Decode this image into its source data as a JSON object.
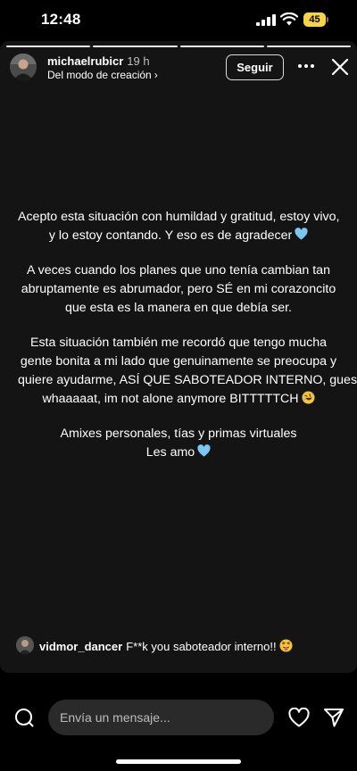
{
  "status_bar": {
    "time": "12:48",
    "battery_level": "45",
    "icons": [
      "signal-icon",
      "wifi-icon",
      "battery-icon"
    ],
    "battery_color": "#f7d548"
  },
  "story": {
    "progress": {
      "segments": 4,
      "current": 4
    },
    "user": {
      "username": "michaelrubicr",
      "age": "19 h",
      "subtitle": "Del modo de creación",
      "subtitle_chevron": "›"
    },
    "follow_label": "Seguir",
    "more_icon": "more-horizontal-icon",
    "close_icon": "close-icon",
    "paragraphs": [
      {
        "lines": [
          "Acepto esta situación con humildad y gratitud, estoy vivo,",
          "y lo estoy contando. Y eso es de agradecer"
        ],
        "emoji": "blue-heart"
      },
      {
        "lines": [
          "A veces cuando los planes que uno tenía cambian tan",
          "abruptamente es abrumador, pero SÉ en mi corazoncito",
          "que esta es la manera en que debía ser."
        ]
      },
      {
        "lines": [
          "Esta situación también me recordó que tengo mucha",
          "gente bonita a mi lado que genuinamente se preocupa y",
          "quiere ayudarme, ASÍ QUE SABOTEADOR INTERNO, guess",
          "whaaaaat, im not alone anymore BITTTTTCH"
        ],
        "emoji": "rolling-laughing"
      },
      {
        "lines": [
          "Amixes personales, tías y primas virtuales",
          "Les amo"
        ],
        "emoji": "blue-heart"
      }
    ],
    "comment": {
      "username": "vidmor_dancer",
      "text": "F**k you saboteador interno!!",
      "emoji": "tongue-wink"
    }
  },
  "bottom_bar": {
    "message_placeholder": "Envía un mensaje...",
    "icons": [
      "camera-icon",
      "heart-icon",
      "send-icon"
    ]
  },
  "colors": {
    "background": "#000000",
    "story_background": "#141414",
    "input_background": "#2a2a2a",
    "heart_emoji": "#7cc6f2"
  }
}
